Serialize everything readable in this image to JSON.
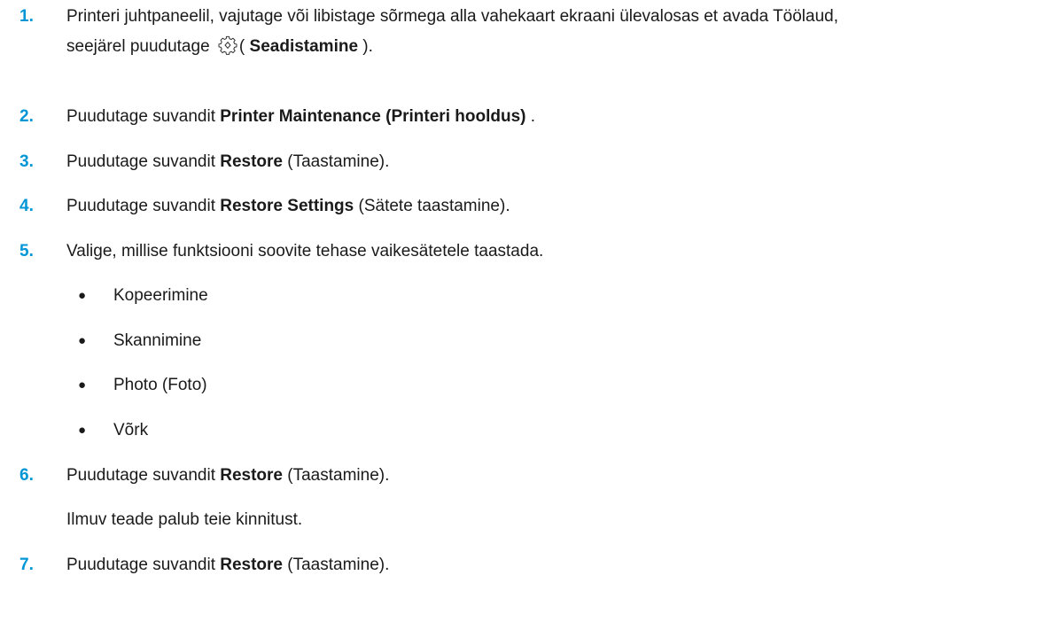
{
  "steps": [
    {
      "number": "1.",
      "line1": "Printeri juhtpaneelil, vajutage või libistage sõrmega alla vahekaart ekraani ülevalosas et avada Töölaud,",
      "line2_prefix": "seejärel puudutage ",
      "icon": "gear-icon",
      "paren_open": "( ",
      "bold": "Seadistamine",
      "paren_close": " )."
    },
    {
      "number": "2.",
      "prefix": "Puudutage suvandit ",
      "bold": "Printer Maintenance (Printeri hooldus)",
      "suffix": " ."
    },
    {
      "number": "3.",
      "prefix": "Puudutage suvandit ",
      "bold": "Restore",
      "suffix": " (Taastamine)."
    },
    {
      "number": "4.",
      "prefix": "Puudutage suvandit ",
      "bold": "Restore Settings",
      "suffix": " (Sätete taastamine)."
    },
    {
      "number": "5.",
      "text": "Valige, millise funktsiooni soovite tehase vaikesätetele taastada."
    },
    {
      "number": "6.",
      "prefix": "Puudutage suvandit ",
      "bold": "Restore",
      "suffix": " (Taastamine).",
      "note": "Ilmuv teade palub teie kinnitust."
    },
    {
      "number": "7.",
      "prefix": "Puudutage suvandit ",
      "bold": "Restore",
      "suffix": " (Taastamine)."
    }
  ],
  "bullets": {
    "symbol": "●",
    "items": [
      "Kopeerimine",
      "Skannimine",
      "Photo (Foto)",
      "Võrk"
    ]
  },
  "colors": {
    "step_number": "#0096d6",
    "text": "#1a1a1a"
  }
}
